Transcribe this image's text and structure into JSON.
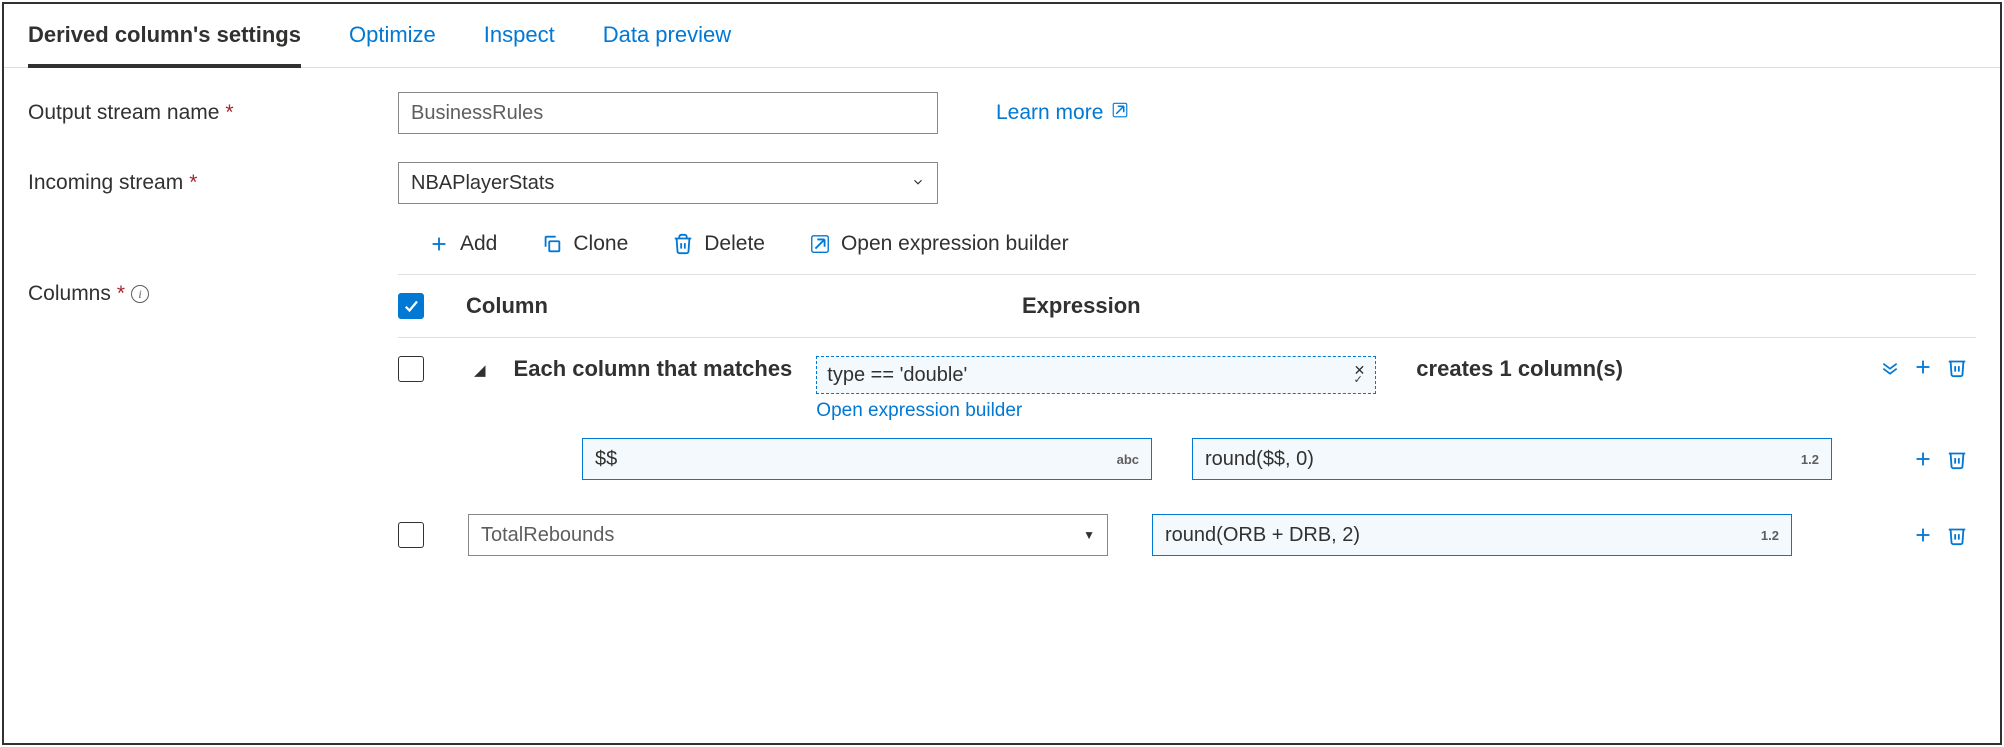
{
  "tabs": {
    "settings": "Derived column's settings",
    "optimize": "Optimize",
    "inspect": "Inspect",
    "preview": "Data preview"
  },
  "labels": {
    "output_stream": "Output stream name",
    "incoming_stream": "Incoming stream",
    "columns": "Columns"
  },
  "values": {
    "output_stream": "BusinessRules",
    "incoming_stream": "NBAPlayerStats"
  },
  "links": {
    "learn_more": "Learn more",
    "open_expression_builder": "Open expression builder"
  },
  "toolbar": {
    "add": "Add",
    "clone": "Clone",
    "delete": "Delete",
    "open_builder": "Open expression builder"
  },
  "table": {
    "header_column": "Column",
    "header_expression": "Expression",
    "pattern": {
      "prefix": "Each column that matches",
      "condition": "type == 'double'",
      "suffix": "creates 1 column(s)",
      "col_value": "$$",
      "col_badge": "abc",
      "exp_value": "round($$, 0)",
      "exp_badge": "1.2"
    },
    "row2": {
      "col_value": "TotalRebounds",
      "exp_value": "round(ORB + DRB, 2)",
      "exp_badge": "1.2"
    }
  }
}
